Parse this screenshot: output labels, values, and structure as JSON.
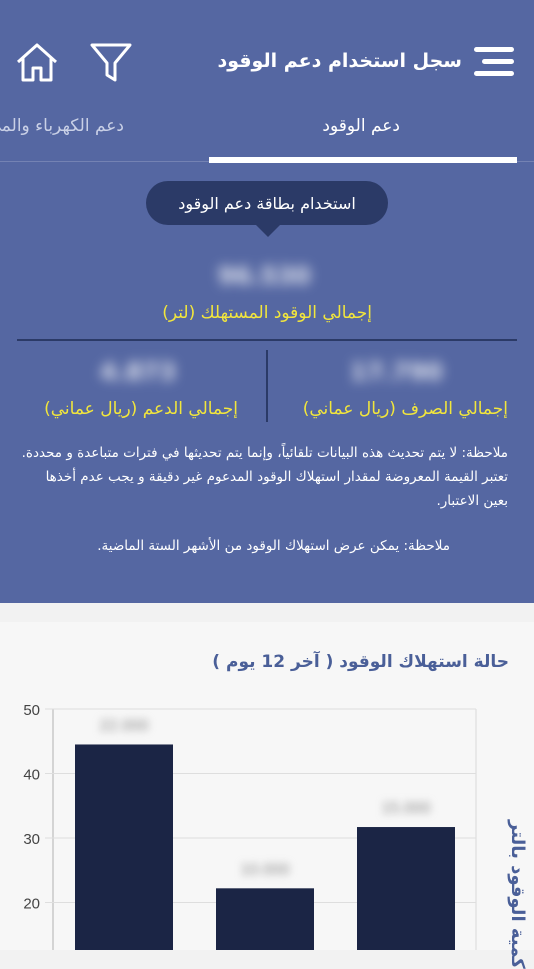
{
  "header": {
    "title": "سجل استخدام دعم الوقود",
    "menu_icon": "hamburger-menu-icon",
    "filter_icon": "filter-icon",
    "home_icon": "home-icon"
  },
  "tabs": [
    {
      "label": "دعم الوقود",
      "active": true
    },
    {
      "label": "دعم الكهرباء والمي",
      "active": false
    }
  ],
  "summary": {
    "badge": "استخدام بطاقة دعم الوقود",
    "total_fuel_value": "96.530",
    "total_fuel_label": "إجمالي الوقود المستهلك (لتر)",
    "total_spent_value": "17.790",
    "total_spent_label": "إجمالي الصرف (ريال عماني)",
    "total_subsidy_value": "4.873",
    "total_subsidy_label": "إجمالي الدعم (ريال عماني)"
  },
  "notes": {
    "note1": "ملاحظة: لا يتم تحديث هذه البيانات تلقائياً، وإنما يتم تحديثها في فترات متباعدة و محددة. تعتبر القيمة المعروضة لمقدار استهلاك الوقود المدعوم غير دقيقة و يجب عدم أخذها بعين الاعتبار.",
    "note2": "ملاحظة: يمكن عرض استهلاك الوقود من الأشهر الستة الماضية."
  },
  "chart_data": {
    "type": "bar",
    "title": "حالة استهلاك الوقود ( آخر 12 يوم )",
    "ylabel": "كمية الوقود بالتر",
    "ylim": [
      0,
      50
    ],
    "yticks": [
      20,
      30,
      40,
      50
    ],
    "values": [
      44.5,
      22.2,
      31.7
    ],
    "bar_labels": [
      "22.000",
      "10.000",
      "15.000"
    ],
    "bar_color": "#1b2545",
    "grid": true
  }
}
